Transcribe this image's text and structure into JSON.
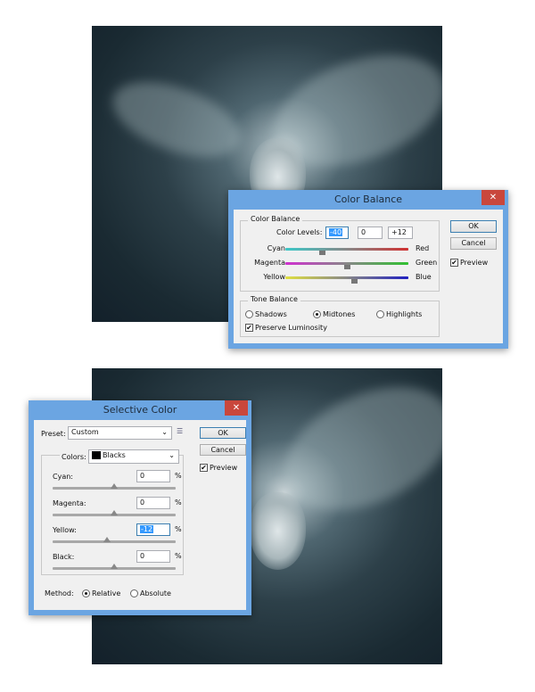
{
  "color_balance": {
    "title": "Color Balance",
    "close": "✕",
    "group_label": "Color Balance",
    "levels_label": "Color Levels:",
    "levels": [
      "-40",
      "0",
      "+12"
    ],
    "sliders": [
      {
        "left": "Cyan",
        "right": "Red",
        "value": -40,
        "from": "#3cc8c8",
        "to": "#d03030"
      },
      {
        "left": "Magenta",
        "right": "Green",
        "value": 0,
        "from": "#d030d0",
        "to": "#30c030"
      },
      {
        "left": "Yellow",
        "right": "Blue",
        "value": 12,
        "from": "#e0e040",
        "to": "#2020c0"
      }
    ],
    "tone_label": "Tone Balance",
    "tones": [
      "Shadows",
      "Midtones",
      "Highlights"
    ],
    "selected_tone": "Midtones",
    "preserve_luminosity": "Preserve Luminosity",
    "ok": "OK",
    "cancel": "Cancel",
    "preview": "Preview"
  },
  "selective_color": {
    "title": "Selective Color",
    "close": "✕",
    "preset_label": "Preset:",
    "preset_value": "Custom",
    "colors_label": "Colors:",
    "colors_value": "Blacks",
    "sliders": [
      {
        "label": "Cyan:",
        "value": "0",
        "pct": "%",
        "num": 0
      },
      {
        "label": "Magenta:",
        "value": "0",
        "pct": "%",
        "num": 0
      },
      {
        "label": "Yellow:",
        "value": "-12",
        "pct": "%",
        "num": -12
      },
      {
        "label": "Black:",
        "value": "0",
        "pct": "%",
        "num": 0
      }
    ],
    "method_label": "Method:",
    "methods": [
      "Relative",
      "Absolute"
    ],
    "selected_method": "Relative",
    "ok": "OK",
    "cancel": "Cancel",
    "preview": "Preview"
  }
}
